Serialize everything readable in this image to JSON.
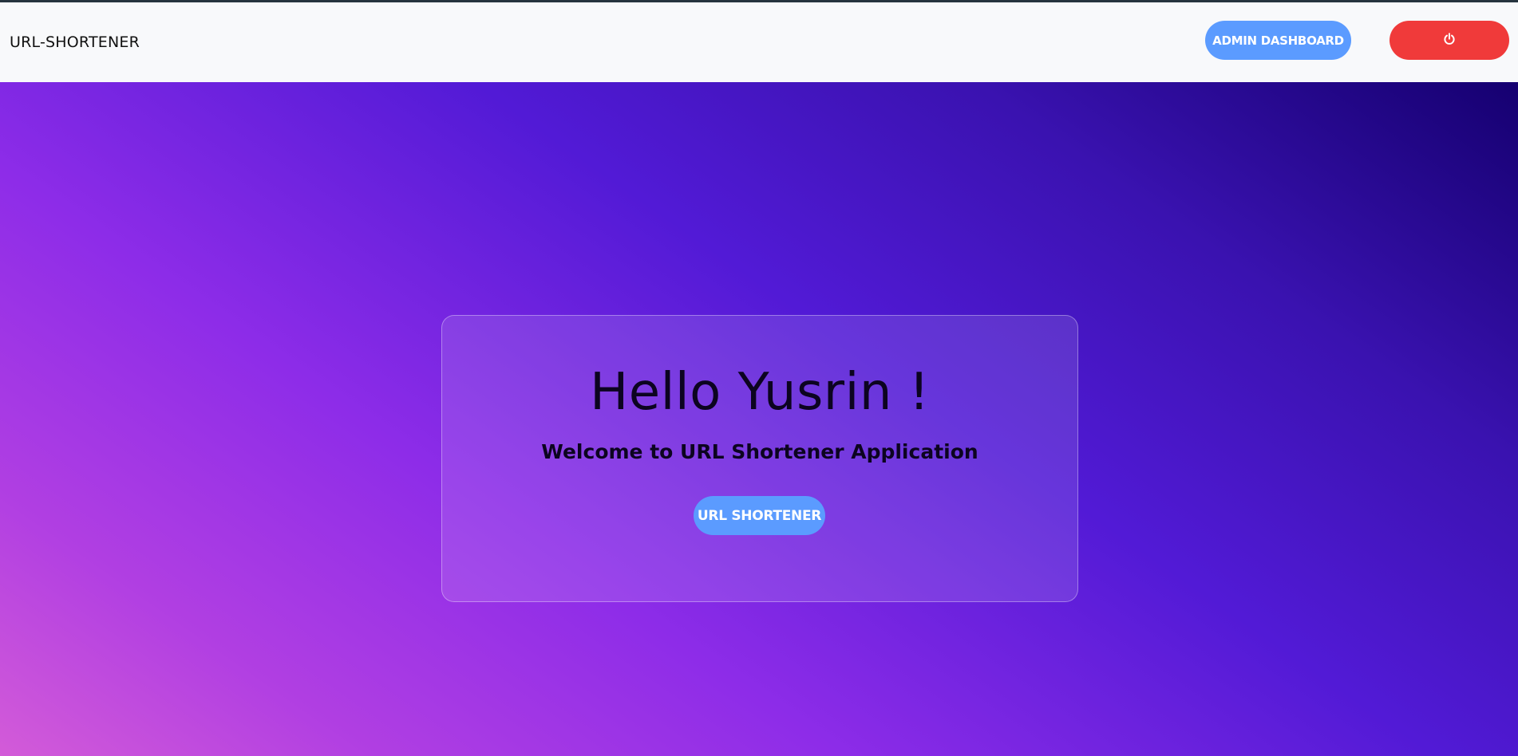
{
  "navbar": {
    "brand": "URL-SHORTENER",
    "admin_dashboard_label": "ADMIN DASHBOARD",
    "logout_icon": "power-icon"
  },
  "hero": {
    "greeting": "Hello Yusrin !",
    "welcome": "Welcome to URL Shortener Application",
    "shortener_button_label": "URL SHORTENER"
  },
  "colors": {
    "navbar_bg": "#f8f9fb",
    "primary_button": "#5b9bff",
    "danger_button": "#f03a3a",
    "gradient_dark": "#150070",
    "gradient_mid": "#521ad6",
    "gradient_purple": "#8d2ce8",
    "gradient_pink": "#d35bd8"
  }
}
